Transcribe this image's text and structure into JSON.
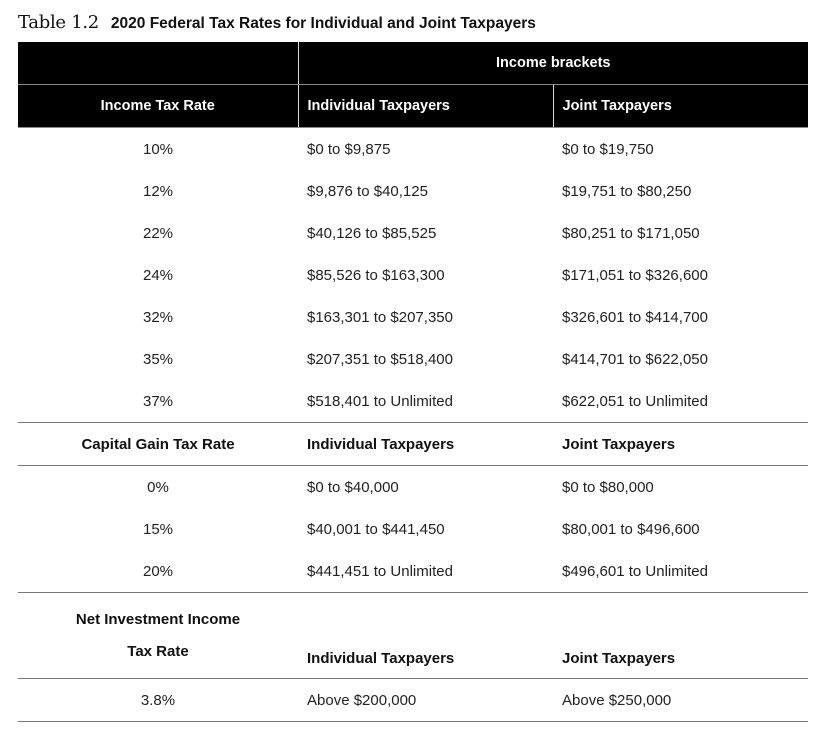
{
  "caption": {
    "label": "Table 1.2",
    "title": "2020 Federal Tax Rates for Individual and Joint Taxpayers"
  },
  "header": {
    "group_label": "Income brackets",
    "rate_label": "Income Tax Rate",
    "individual_label": "Individual Taxpayers",
    "joint_label": "Joint Taxpayers"
  },
  "income_tax": [
    {
      "rate": "10%",
      "individual": "$0 to $9,875",
      "joint": "$0 to $19,750"
    },
    {
      "rate": "12%",
      "individual": "$9,876 to $40,125",
      "joint": "$19,751 to $80,250"
    },
    {
      "rate": "22%",
      "individual": "$40,126 to $85,525",
      "joint": "$80,251 to $171,050"
    },
    {
      "rate": "24%",
      "individual": "$85,526 to $163,300",
      "joint": "$171,051 to $326,600"
    },
    {
      "rate": "32%",
      "individual": "$163,301 to $207,350",
      "joint": "$326,601 to $414,700"
    },
    {
      "rate": "35%",
      "individual": "$207,351 to $518,400",
      "joint": "$414,701 to $622,050"
    },
    {
      "rate": "37%",
      "individual": "$518,401 to Unlimited",
      "joint": "$622,051 to Unlimited"
    }
  ],
  "capital_gains_header": {
    "rate_label": "Capital Gain Tax Rate",
    "individual_label": "Individual Taxpayers",
    "joint_label": "Joint Taxpayers"
  },
  "capital_gains": [
    {
      "rate": "0%",
      "individual": "$0 to $40,000",
      "joint": "$0 to $80,000"
    },
    {
      "rate": "15%",
      "individual": "$40,001 to $441,450",
      "joint": "$80,001 to $496,600"
    },
    {
      "rate": "20%",
      "individual": "$441,451 to Unlimited",
      "joint": "$496,601 to Unlimited"
    }
  ],
  "niit_header": {
    "rate_label_line1": "Net Investment Income",
    "rate_label_line2": "Tax Rate",
    "individual_label": "Individual Taxpayers",
    "joint_label": "Joint Taxpayers"
  },
  "niit": [
    {
      "rate": "3.8%",
      "individual": "Above $200,000",
      "joint": "Above $250,000"
    }
  ]
}
